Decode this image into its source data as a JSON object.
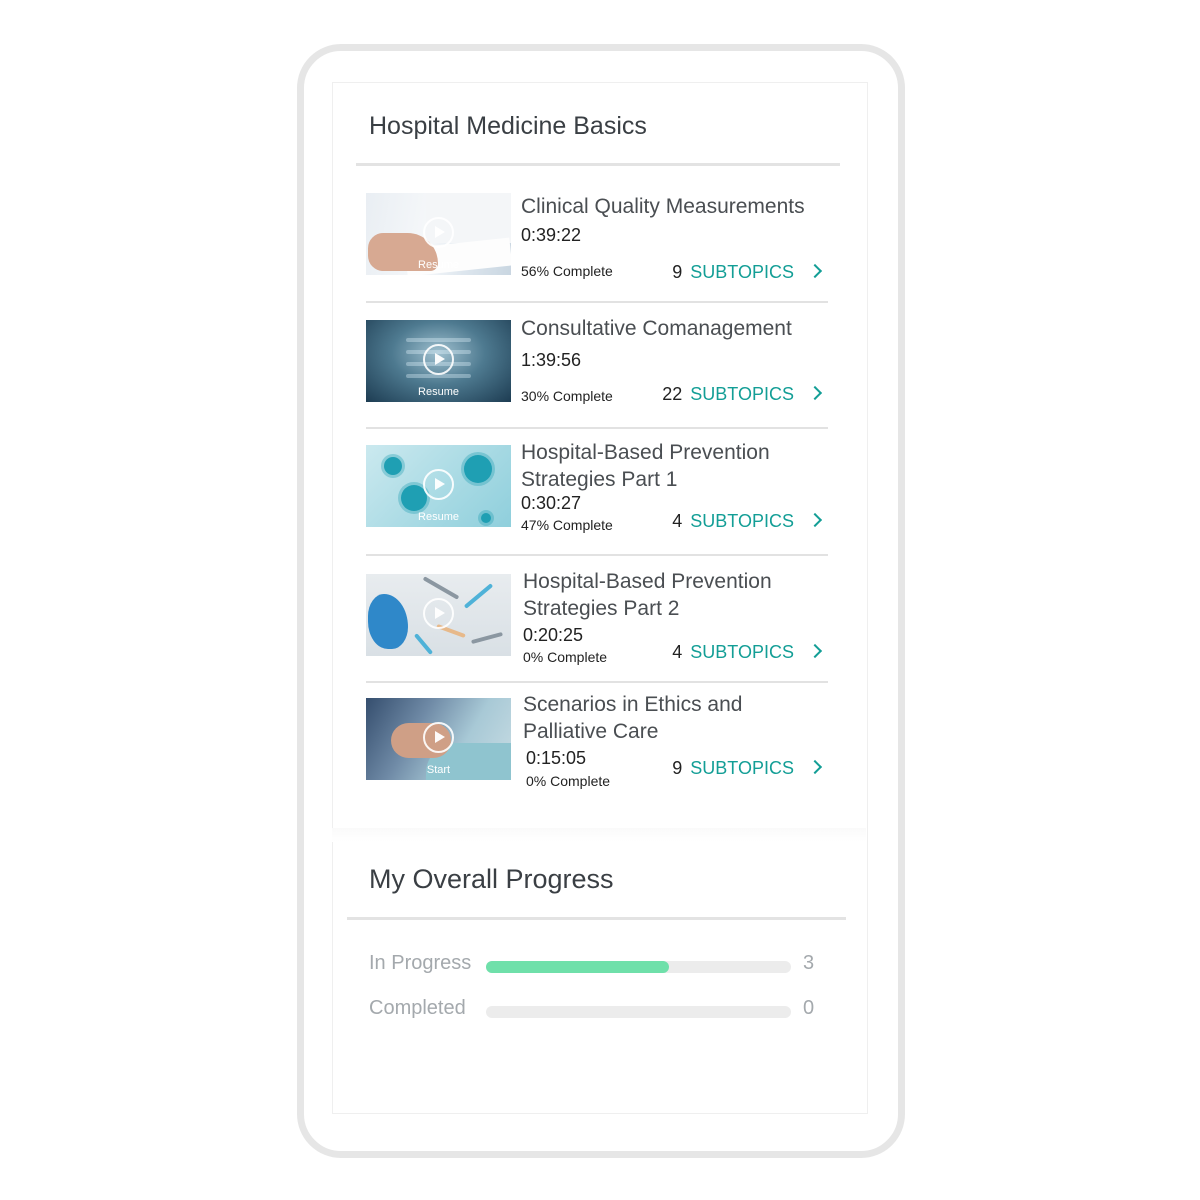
{
  "card": {
    "title": "Hospital Medicine Basics"
  },
  "courses": [
    {
      "title_lines": [
        "Clinical Quality Measurements"
      ],
      "duration": "0:39:22",
      "percent_label": "56% Complete",
      "subtopic_count": "9",
      "subtopics_label": "SUBTOPICS",
      "thumb_label": "Resume",
      "thumb_icon": "play-icon"
    },
    {
      "title_lines": [
        "Consultative Comanagement"
      ],
      "duration": "1:39:56",
      "percent_label": "30% Complete",
      "subtopic_count": "22",
      "subtopics_label": "SUBTOPICS",
      "thumb_label": "Resume",
      "thumb_icon": "play-icon"
    },
    {
      "title_lines": [
        "Hospital-Based Prevention",
        "Strategies Part 1"
      ],
      "duration": "0:30:27",
      "percent_label": "47% Complete",
      "subtopic_count": "4",
      "subtopics_label": "SUBTOPICS",
      "thumb_label": "Resume",
      "thumb_icon": "play-icon"
    },
    {
      "title_lines": [
        "Hospital-Based Prevention",
        "Strategies Part 2"
      ],
      "duration": "0:20:25",
      "percent_label": "0% Complete",
      "subtopic_count": "4",
      "subtopics_label": "SUBTOPICS",
      "thumb_label": "",
      "thumb_icon": "play-icon"
    },
    {
      "title_lines": [
        "Scenarios in Ethics and",
        "Palliative Care"
      ],
      "duration": "0:15:05",
      "percent_label": "0% Complete",
      "subtopic_count": "9",
      "subtopics_label": "SUBTOPICS",
      "thumb_label": "Start",
      "thumb_icon": "play-icon"
    }
  ],
  "progress": {
    "title": "My Overall Progress",
    "rows": [
      {
        "label": "In Progress",
        "count": "3",
        "fill_fraction": 0.6
      },
      {
        "label": "Completed",
        "count": "0",
        "fill_fraction": 0
      }
    ]
  },
  "colors": {
    "accent": "#139e96",
    "progress_fill": "#6fe0aa",
    "track": "#ececec"
  }
}
